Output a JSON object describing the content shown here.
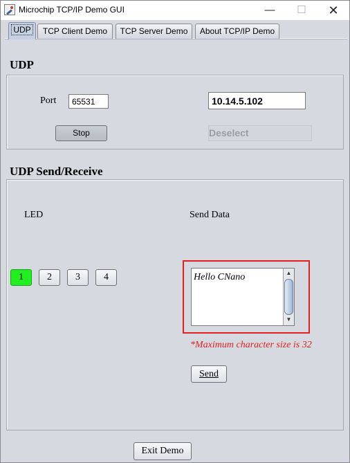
{
  "window": {
    "title": "Microchip TCP/IP Demo GUI",
    "min_glyph": "—",
    "max_glyph": "☐",
    "close_glyph": "✕"
  },
  "tabs": [
    {
      "label": "UDP",
      "active": true
    },
    {
      "label": "TCP Client Demo",
      "active": false
    },
    {
      "label": "TCP Server Demo",
      "active": false
    },
    {
      "label": "About TCP/IP Demo",
      "active": false
    }
  ],
  "udp": {
    "title": "UDP",
    "port_label": "Port",
    "port_value": "65531",
    "ip_value": "10.14.5.102",
    "stop_label": "Stop",
    "deselect_label": "Deselect"
  },
  "send_receive": {
    "title": "UDP Send/Receive",
    "led_label": "LED",
    "led_buttons": [
      "1",
      "2",
      "3",
      "4"
    ],
    "led_on_color": "#22ee22",
    "send_data_label": "Send Data",
    "send_text": "Hello CNano",
    "max_note": "*Maximum character size is 32",
    "highlight_color": "#e02020",
    "send_label": "Send",
    "scroll_up": "▲",
    "scroll_down": "▼"
  },
  "exit_label": "Exit Demo"
}
